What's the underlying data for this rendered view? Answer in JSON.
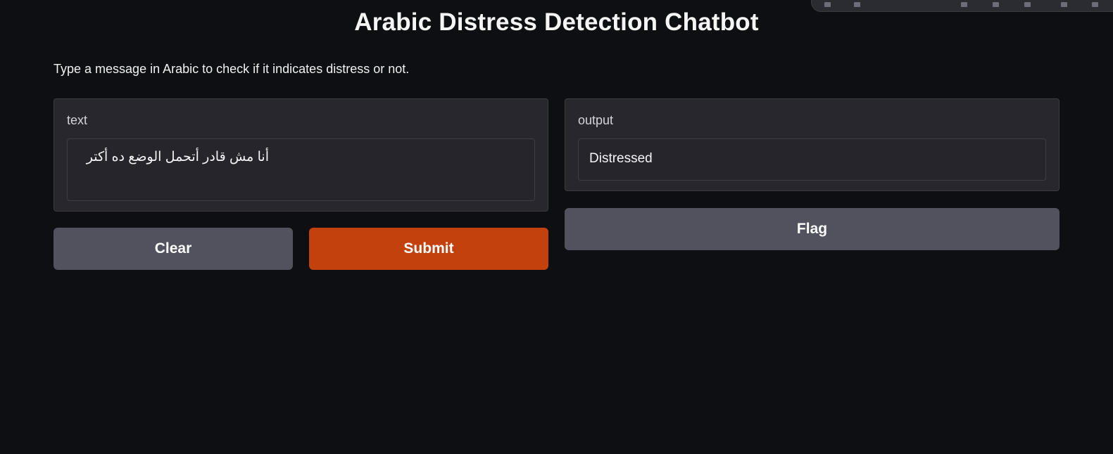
{
  "app": {
    "title": "Arabic Distress Detection Chatbot",
    "description": "Type a message in Arabic to check if it indicates distress or not."
  },
  "input": {
    "label": "text",
    "value": "أنا مش قادر أتحمل الوضع ده أكتر"
  },
  "output": {
    "label": "output",
    "value": "Distressed"
  },
  "buttons": {
    "clear_label": "Clear",
    "submit_label": "Submit",
    "flag_label": "Flag"
  },
  "colors": {
    "background": "#0e0f12",
    "panel": "#27272d",
    "secondary_button": "#52525e",
    "primary_button": "#c2410c"
  }
}
